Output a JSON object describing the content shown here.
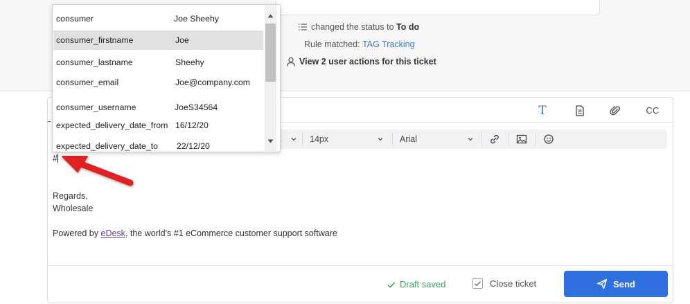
{
  "timeline": {
    "status_prefix": "changed the status to",
    "status_value": "To do",
    "rule_prefix": "Rule matched:",
    "rule_link": "TAG Tracking",
    "actions_text": "View 2 user actions for this ticket"
  },
  "composer": {
    "tabs": {
      "text_icon_glyph": "T",
      "cc_label": "CC"
    },
    "toolbar": {
      "partial_label": ".",
      "font_size": "14px",
      "font_family": "Arial"
    },
    "body": {
      "typed": "#",
      "regards": "Regards,",
      "signature": "Wholesale",
      "powered_prefix": "Powered by",
      "powered_link": "eDesk",
      "powered_suffix": ", the world's #1 eCommerce customer support software"
    },
    "footer": {
      "draft_status": "Draft saved",
      "close_ticket_label": "Close ticket",
      "send_label": "Send"
    }
  },
  "dropdown": {
    "items": [
      {
        "key": "consumer",
        "value": "Joe Sheehy"
      },
      {
        "key": "consumer_firstname",
        "value": "Joe"
      },
      {
        "key": "consumer_lastname",
        "value": "Sheehy"
      },
      {
        "key": "consumer_email",
        "value": "Joe@company.com"
      },
      {
        "key": "consumer_username",
        "value": "JoeS34564"
      },
      {
        "key": "expected_delivery_date_from",
        "value": "16/12/20"
      },
      {
        "key": "expected_delivery_date_to",
        "value": "22/12/20"
      }
    ]
  },
  "colors": {
    "accent": "#2f6fe0",
    "link": "#3b78c6",
    "success": "#3aa35a",
    "annotation_arrow": "#e02020"
  }
}
